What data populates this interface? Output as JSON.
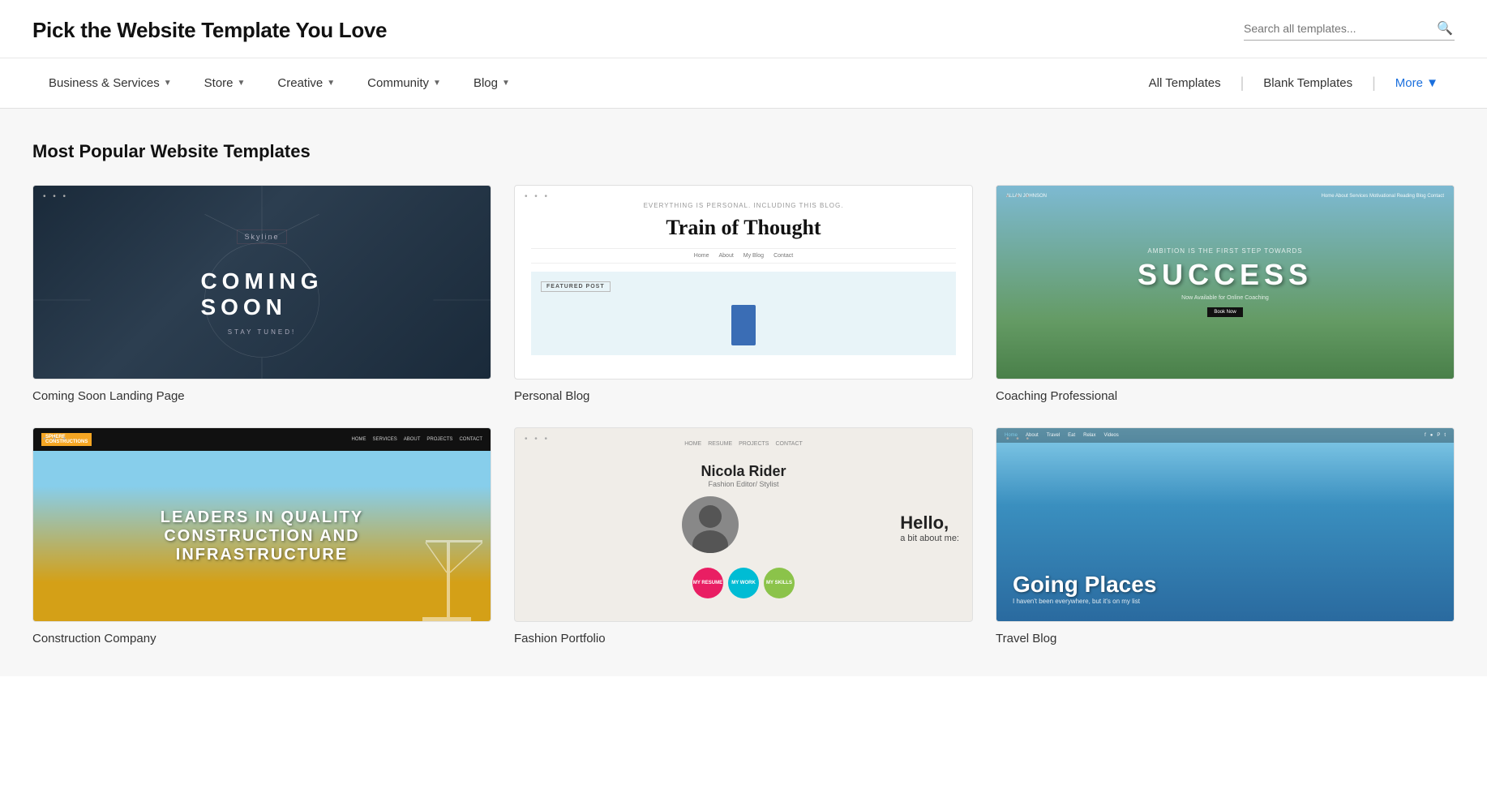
{
  "header": {
    "title": "Pick the Website Template You Love",
    "search": {
      "placeholder": "Search all templates..."
    }
  },
  "nav": {
    "items": [
      {
        "label": "Business & Services",
        "hasDropdown": true
      },
      {
        "label": "Store",
        "hasDropdown": true
      },
      {
        "label": "Creative",
        "hasDropdown": true
      },
      {
        "label": "Community",
        "hasDropdown": true
      },
      {
        "label": "Blog",
        "hasDropdown": true
      }
    ],
    "right": [
      {
        "label": "All Templates",
        "type": "normal"
      },
      {
        "label": "Blank Templates",
        "type": "normal"
      },
      {
        "label": "More",
        "type": "blue",
        "hasDropdown": true
      }
    ]
  },
  "section": {
    "title": "Most Popular Website Templates"
  },
  "templates": [
    {
      "name": "Coming Soon Landing Page",
      "type": "coming-soon"
    },
    {
      "name": "Personal Blog",
      "type": "blog"
    },
    {
      "name": "Coaching Professional",
      "type": "success"
    },
    {
      "name": "Construction Company",
      "type": "construction"
    },
    {
      "name": "Fashion Portfolio",
      "type": "portfolio"
    },
    {
      "name": "Travel Blog",
      "type": "travel"
    }
  ]
}
